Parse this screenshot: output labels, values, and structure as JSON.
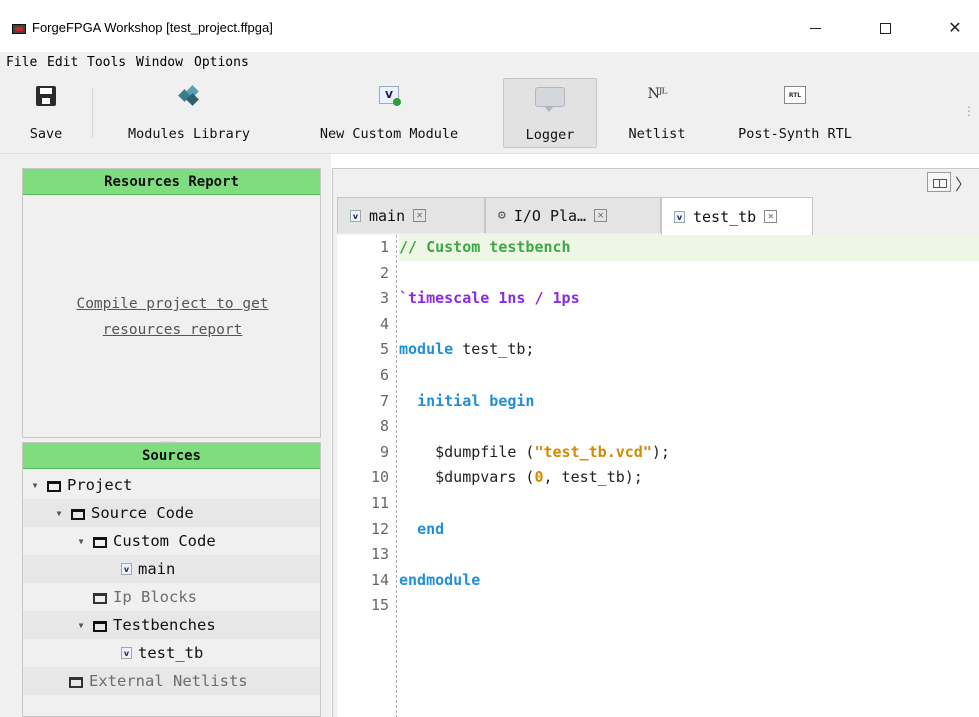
{
  "window": {
    "title": "ForgeFPGA Workshop [test_project.ffpga]",
    "minimize": "—",
    "maximize": "☐",
    "close": "✕"
  },
  "menu": [
    "File",
    "Edit",
    "Tools",
    "Window",
    "Options"
  ],
  "toolbar": {
    "save": "Save",
    "modules_library": "Modules Library",
    "new_custom_module": "New Custom Module",
    "logger": "Logger",
    "netlist": "Netlist",
    "post_synth_rtl": "Post-Synth RTL",
    "rtl_icon_text": "RTL",
    "new_icon_text": "V",
    "netlist_icon_text": "Nᴶᴸ",
    "overflow": "⋮",
    "logger_pressed": true
  },
  "resources": {
    "title": "Resources Report",
    "message_line1": "Compile project to get",
    "message_line2": "resources report"
  },
  "sources": {
    "title": "Sources",
    "tree": {
      "project": "Project",
      "source_code": "Source Code",
      "custom_code": "Custom Code",
      "main": "main",
      "ip_blocks": "Ip Blocks",
      "testbenches": "Testbenches",
      "test_tb": "test_tb",
      "external_netlists": "External Netlists"
    }
  },
  "editor": {
    "tabs": [
      {
        "label": "main",
        "active": false
      },
      {
        "label": "I/O Pla…",
        "active": false
      },
      {
        "label": "test_tb",
        "active": true
      }
    ],
    "line_numbers": [
      "1",
      "2",
      "3",
      "4",
      "5",
      "6",
      "7",
      "8",
      "9",
      "10",
      "11",
      "12",
      "13",
      "14",
      "15"
    ],
    "code": {
      "l1": "// Custom testbench",
      "l3": "`timescale 1ns / 1ps",
      "l5_kw": "module",
      "l5_rest": " test_tb;",
      "l7_kw": "initial begin",
      "l9_a": "$dumpfile (",
      "l9_str": "\"test_tb.vcd\"",
      "l9_b": ");",
      "l10_a": "$dumpvars (",
      "l10_num": "0",
      "l10_b": ", test_tb);",
      "l12_kw": "end",
      "l14_kw": "endmodule"
    }
  },
  "colors": {
    "panel_header": "#7fdd7f",
    "comment": "#3fa845",
    "directive": "#8a2be2",
    "keyword": "#1f8fd8",
    "string": "#d38a00"
  }
}
